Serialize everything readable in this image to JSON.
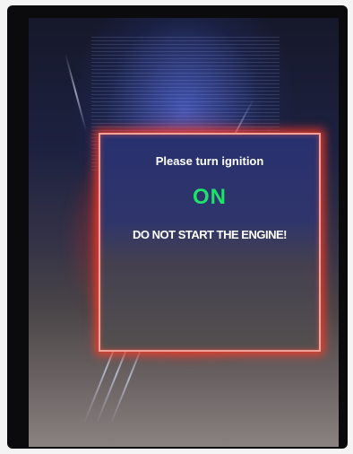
{
  "dialog": {
    "line1": "Please turn ignition",
    "status": "ON",
    "warning": "DO NOT START THE ENGINE!"
  },
  "colors": {
    "status_green": "#1fe26a",
    "frame_red": "#ff3c28",
    "text_white": "#ffffff"
  }
}
